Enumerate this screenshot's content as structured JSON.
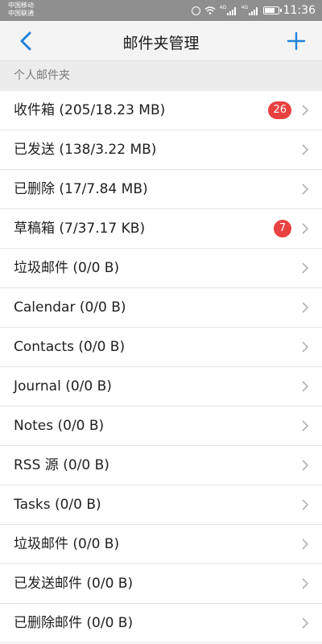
{
  "status_bar": {
    "carrier_1": "中国移动",
    "carrier_2": "中国联通",
    "network_tag_1": "4G",
    "network_tag_2": "4G",
    "time": "11:36",
    "icons": [
      "alarm-icon",
      "wifi-icon",
      "signal-icon",
      "signal-icon",
      "battery-icon"
    ]
  },
  "header": {
    "title": "邮件夹管理",
    "back_icon": "chevron-left-icon",
    "add_icon": "plus-icon",
    "accent_color": "#1f82d9"
  },
  "section": {
    "title": "个人邮件夹"
  },
  "badge_color": "#e94040",
  "folders": [
    {
      "label": "收件箱 (205/18.23 MB)",
      "badge": "26"
    },
    {
      "label": "已发送 (138/3.22 MB)",
      "badge": ""
    },
    {
      "label": "已删除 (17/7.84 MB)",
      "badge": ""
    },
    {
      "label": "草稿箱 (7/37.17 KB)",
      "badge": "7"
    },
    {
      "label": "垃圾邮件 (0/0 B)",
      "badge": ""
    },
    {
      "label": "Calendar (0/0 B)",
      "badge": ""
    },
    {
      "label": "Contacts (0/0 B)",
      "badge": ""
    },
    {
      "label": "Journal (0/0 B)",
      "badge": ""
    },
    {
      "label": "Notes (0/0 B)",
      "badge": ""
    },
    {
      "label": "RSS 源 (0/0 B)",
      "badge": ""
    },
    {
      "label": "Tasks (0/0 B)",
      "badge": ""
    },
    {
      "label": "垃圾邮件 (0/0 B)",
      "badge": ""
    },
    {
      "label": "已发送邮件 (0/0 B)",
      "badge": ""
    },
    {
      "label": "已删除邮件 (0/0 B)",
      "badge": ""
    }
  ]
}
